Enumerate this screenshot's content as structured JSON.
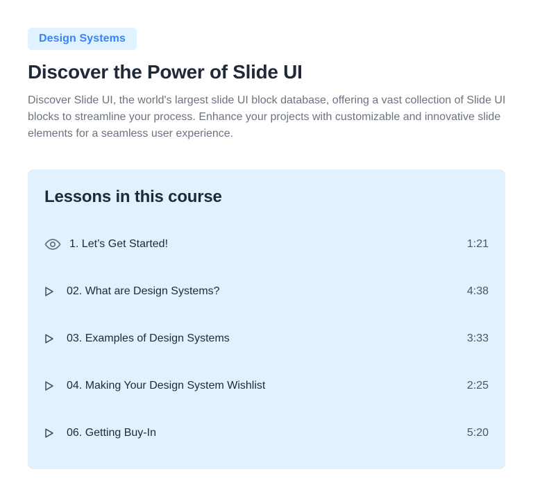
{
  "header": {
    "badge": "Design Systems",
    "title": "Discover the Power of Slide UI",
    "description": "Discover Slide UI, the world's largest slide UI block database, offering a vast collection of Slide UI blocks to streamline your process. Enhance your projects with customizable and innovative slide elements for a seamless user experience."
  },
  "course": {
    "heading": "Lessons in this course",
    "lessons": [
      {
        "label": "1. Let’s Get Started!",
        "duration": "1:21",
        "icon": "eye-icon"
      },
      {
        "label": "02. What are Design Systems?",
        "duration": "4:38",
        "icon": "play-icon"
      },
      {
        "label": "03. Examples of Design Systems",
        "duration": "3:33",
        "icon": "play-icon"
      },
      {
        "label": "04. Making Your Design System Wishlist",
        "duration": "2:25",
        "icon": "play-icon"
      },
      {
        "label": "06. Getting Buy-In",
        "duration": "5:20",
        "icon": "play-icon"
      }
    ]
  },
  "colors": {
    "accent": "#3b82f6",
    "panel_bg": "#e0f2fe",
    "heading": "#1f2937",
    "muted": "#6b7280"
  }
}
